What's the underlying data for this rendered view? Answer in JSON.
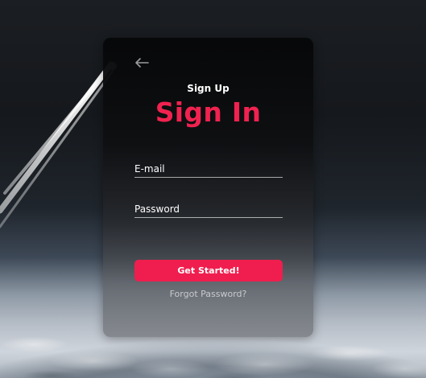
{
  "form": {
    "sub_heading": "Sign Up",
    "title": "Sign In",
    "email_placeholder": "E-mail",
    "password_placeholder": "Password",
    "submit_label": "Get Started!",
    "forgot_label": "Forgot Password?"
  },
  "icons": {
    "back": "arrow-left-icon"
  },
  "colors": {
    "accent": "#f0224f",
    "card_top": "#060708",
    "text": "#ffffff",
    "muted_text": "#c9cacc"
  }
}
